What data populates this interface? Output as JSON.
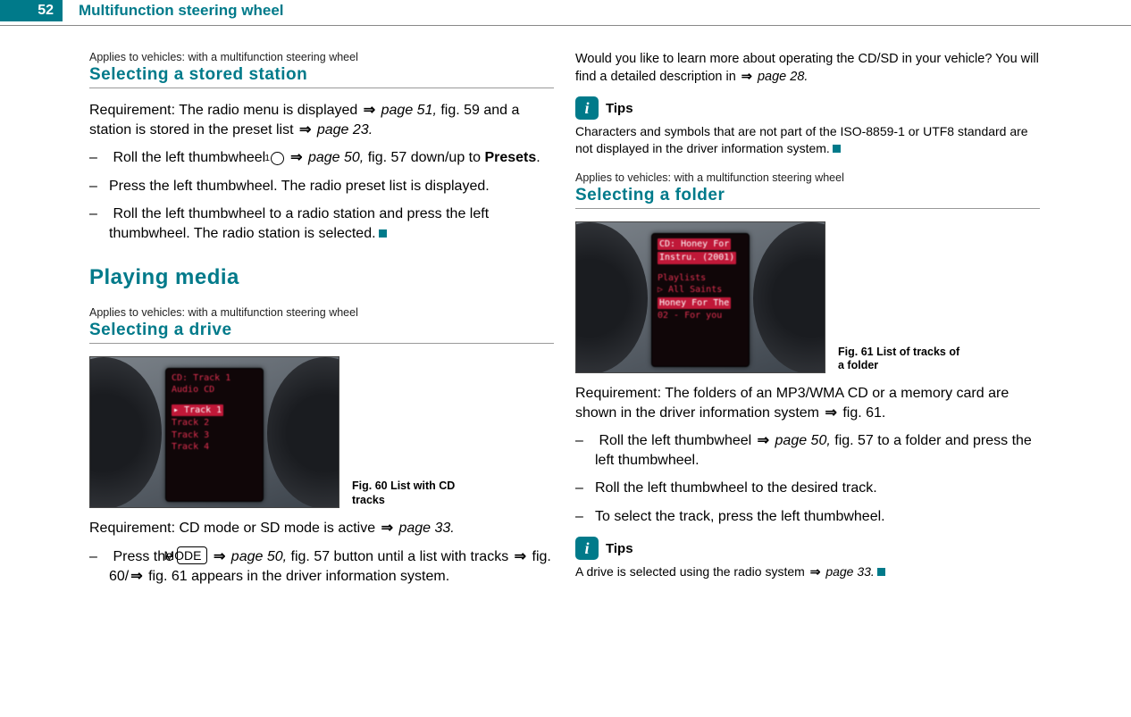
{
  "header": {
    "page_number": "52",
    "chapter": "Multifunction steering wheel"
  },
  "left": {
    "applies1": "Applies to vehicles: with a multifunction steering wheel",
    "h3_1": "Selecting a stored station",
    "req1_a": "Requirement: The radio menu is displayed ",
    "req1_b": "page 51,",
    "req1_c": " fig. 59 and a station is stored in the preset list ",
    "req1_d": "page 23.",
    "li1_a": "Roll the left thumbwheel ",
    "li1_circled": "1",
    "li1_b": "page 50,",
    "li1_c": " fig. 57 down/up to ",
    "li1_presets": "Presets",
    "li1_d": ".",
    "li2": "Press the left thumbwheel. The radio preset list is displayed.",
    "li3": "Roll the left thumbwheel to a radio station and press the left thumbwheel. The radio station is selected.",
    "h2": "Playing media",
    "applies2": "Applies to vehicles: with a multifunction steering wheel",
    "h3_2": "Selecting a drive",
    "fig60_cap": "Fig. 60   List with CD tracks",
    "fig60_title1": "CD: Track 1",
    "fig60_title2": "Audio CD",
    "fig60_r1": "Track 1",
    "fig60_r2": "Track 2",
    "fig60_r3": "Track 3",
    "fig60_r4": "Track 4",
    "req2_a": "Requirement: CD mode or SD mode is active ",
    "req2_b": "page 33.",
    "li4_a": "Press the ",
    "li4_mode": "MODE",
    "li4_b": "page 50,",
    "li4_c": " fig. 57 button until a list with tracks ",
    "li4_d": "fig. 60/",
    "li4_e": "fig. 61 appears in the driver information system."
  },
  "right": {
    "intro_a": "Would you like to learn more about operating the CD/SD in your vehicle? You will find a detailed description in ",
    "intro_b": "page 28.",
    "tips1_label": "Tips",
    "tips1_text": "Characters and symbols that are not part of the ISO-8859-1 or UTF8 standard are not displayed in the driver information system.",
    "applies3": "Applies to vehicles: with a multifunction steering wheel",
    "h3_3": "Selecting a folder",
    "fig61_cap": "Fig. 61   List of tracks of a folder",
    "fig61_t1": "CD: Honey For",
    "fig61_t2": "Instru. (2001)",
    "fig61_r1": "Playlists",
    "fig61_r2": "▷ All Saints",
    "fig61_r3": "Honey For The",
    "fig61_r4": "02 - For you",
    "req3_a": "Requirement: The folders of an MP3/WMA CD or a memory card are shown in the driver information system ",
    "req3_b": "fig. 61.",
    "li5_a": "Roll the left thumbwheel ",
    "li5_b": "page 50,",
    "li5_c": " fig. 57 to a folder and press the left thumbwheel.",
    "li6": "Roll the left thumbwheel to the desired track.",
    "li7": "To select the track, press the left thumbwheel.",
    "tips2_label": "Tips",
    "tips2_a": "A drive is selected using the radio system ",
    "tips2_b": "page 33."
  }
}
